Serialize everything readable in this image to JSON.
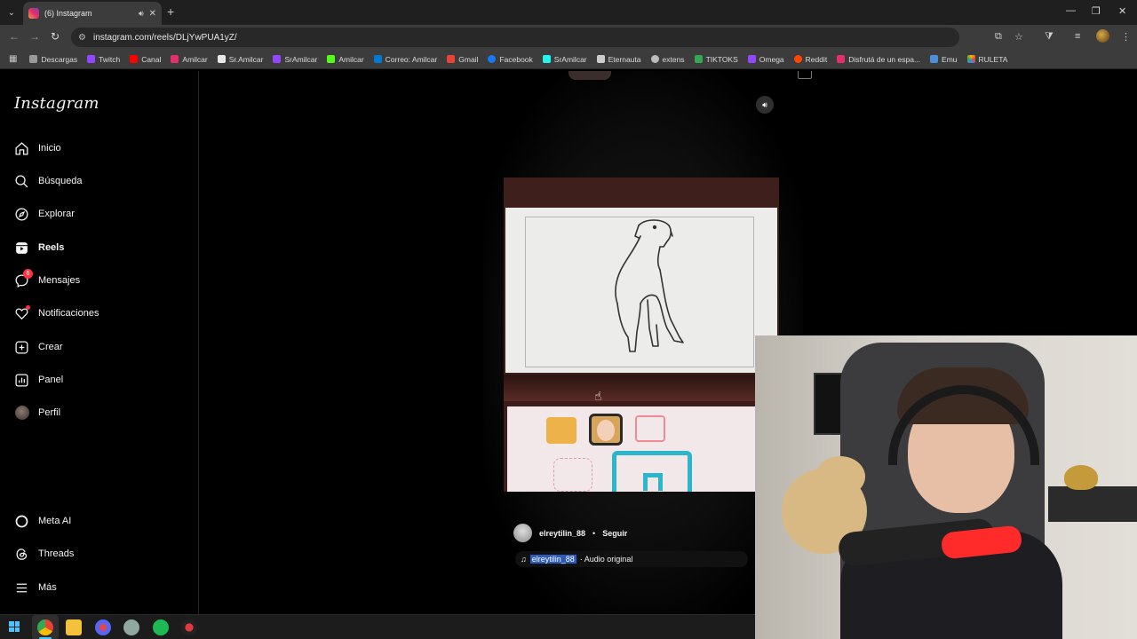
{
  "browser": {
    "tab_title": "(6) Instagram",
    "url": "instagram.com/reels/DLjYwPUA1yZ/",
    "bookmarks": [
      {
        "label": "Descargas",
        "color": "#9a9a9a"
      },
      {
        "label": "Twitch",
        "color": "#9146ff"
      },
      {
        "label": "Canal",
        "color": "#ff0000"
      },
      {
        "label": "Amilcar",
        "color": "#e1306c"
      },
      {
        "label": "Sr.Amilcar",
        "color": "#e8e8e8"
      },
      {
        "label": "SrAmilcar",
        "color": "#9146ff"
      },
      {
        "label": "Amilcar",
        "color": "#53fc18"
      },
      {
        "label": "Correo: Amilcar",
        "color": "#0078d4"
      },
      {
        "label": "Gmail",
        "color": "#ea4335"
      },
      {
        "label": "Facebook",
        "color": "#1877f2"
      },
      {
        "label": "SrAmilcar",
        "color": "#25f4ee"
      },
      {
        "label": "Eternauta",
        "color": "#cccccc"
      },
      {
        "label": "extens",
        "color": "#bbbbbb"
      },
      {
        "label": "TIKTOKS",
        "color": "#34a853"
      },
      {
        "label": "Omega",
        "color": "#9146ff"
      },
      {
        "label": "Reddit",
        "color": "#ff4500"
      },
      {
        "label": "Disfrutá de un espa...",
        "color": "#e1306c"
      },
      {
        "label": "Emu",
        "color": "#4a90d9"
      },
      {
        "label": "RULETA",
        "color": "#f4b400"
      }
    ]
  },
  "instagram": {
    "logo": "Instagram",
    "nav": [
      {
        "label": "Inicio",
        "icon": "home-icon"
      },
      {
        "label": "Búsqueda",
        "icon": "search-icon"
      },
      {
        "label": "Explorar",
        "icon": "compass-icon"
      },
      {
        "label": "Reels",
        "icon": "reels-icon"
      },
      {
        "label": "Mensajes",
        "icon": "messenger-icon",
        "badge": "6"
      },
      {
        "label": "Notificaciones",
        "icon": "heart-icon"
      },
      {
        "label": "Crear",
        "icon": "plus-square-icon"
      },
      {
        "label": "Panel",
        "icon": "chart-icon"
      },
      {
        "label": "Perfil",
        "icon": "avatar"
      }
    ],
    "bottom_nav": [
      {
        "label": "Meta AI",
        "icon": "meta-ai-icon"
      },
      {
        "label": "Threads",
        "icon": "threads-icon"
      },
      {
        "label": "Más",
        "icon": "menu-icon"
      }
    ],
    "reel": {
      "username": "elreytilin_88",
      "separator": "•",
      "follow_label": "Seguir",
      "audio_user": "elreytilin_88",
      "audio_suffix": "· Audio original"
    }
  },
  "colors": {
    "instagram_bg": "#000000",
    "badge_red": "#ff3040",
    "chrome_toolbar": "#3c3c3c",
    "mic_red": "#ff2b2b"
  }
}
